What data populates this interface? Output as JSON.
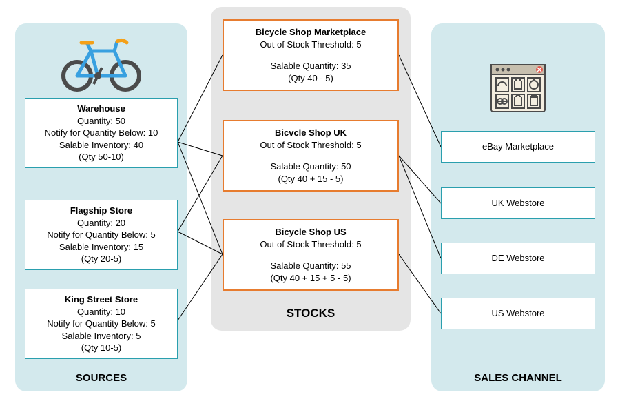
{
  "labels": {
    "sources": "SOURCES",
    "stocks": "STOCKS",
    "sales": "SALES CHANNEL"
  },
  "sources": [
    {
      "name": "Warehouse",
      "qty_line": "Quantity: 50",
      "notify_line": "Notify for Quantity Below: 10",
      "salable_line": "Salable Inventory: 40",
      "calc": "(Qty 50-10)"
    },
    {
      "name": "Flagship Store",
      "qty_line": "Quantity: 20",
      "notify_line": "Notify for Quantity Below: 5",
      "salable_line": "Salable Inventory: 15",
      "calc": "(Qty 20-5)"
    },
    {
      "name": "King Street Store",
      "qty_line": "Quantity: 10",
      "notify_line": "Notify for Quantity Below: 5",
      "salable_line": "Salable Inventory: 5",
      "calc": "(Qty 10-5)"
    }
  ],
  "stocks": [
    {
      "name": "Bicycle Shop Marketplace",
      "threshold": "Out of Stock Threshold: 5",
      "salable": "Salable Quantity: 35",
      "calc": "(Qty 40 - 5)"
    },
    {
      "name": "Bicvcle Shop UK",
      "threshold": "Out of Stock Threshold: 5",
      "salable": "Salable Quantity: 50",
      "calc": "(Qty 40 + 15 - 5)"
    },
    {
      "name": "Bicycle Shop US",
      "threshold": "Out of Stock Threshold: 5",
      "salable": "Salable Quantity: 55",
      "calc": "(Qty 40 + 15 + 5 - 5)"
    }
  ],
  "sales": [
    {
      "name": "eBay Marketplace"
    },
    {
      "name": "UK Webstore"
    },
    {
      "name": "DE Webstore"
    },
    {
      "name": "US Webstore"
    }
  ]
}
